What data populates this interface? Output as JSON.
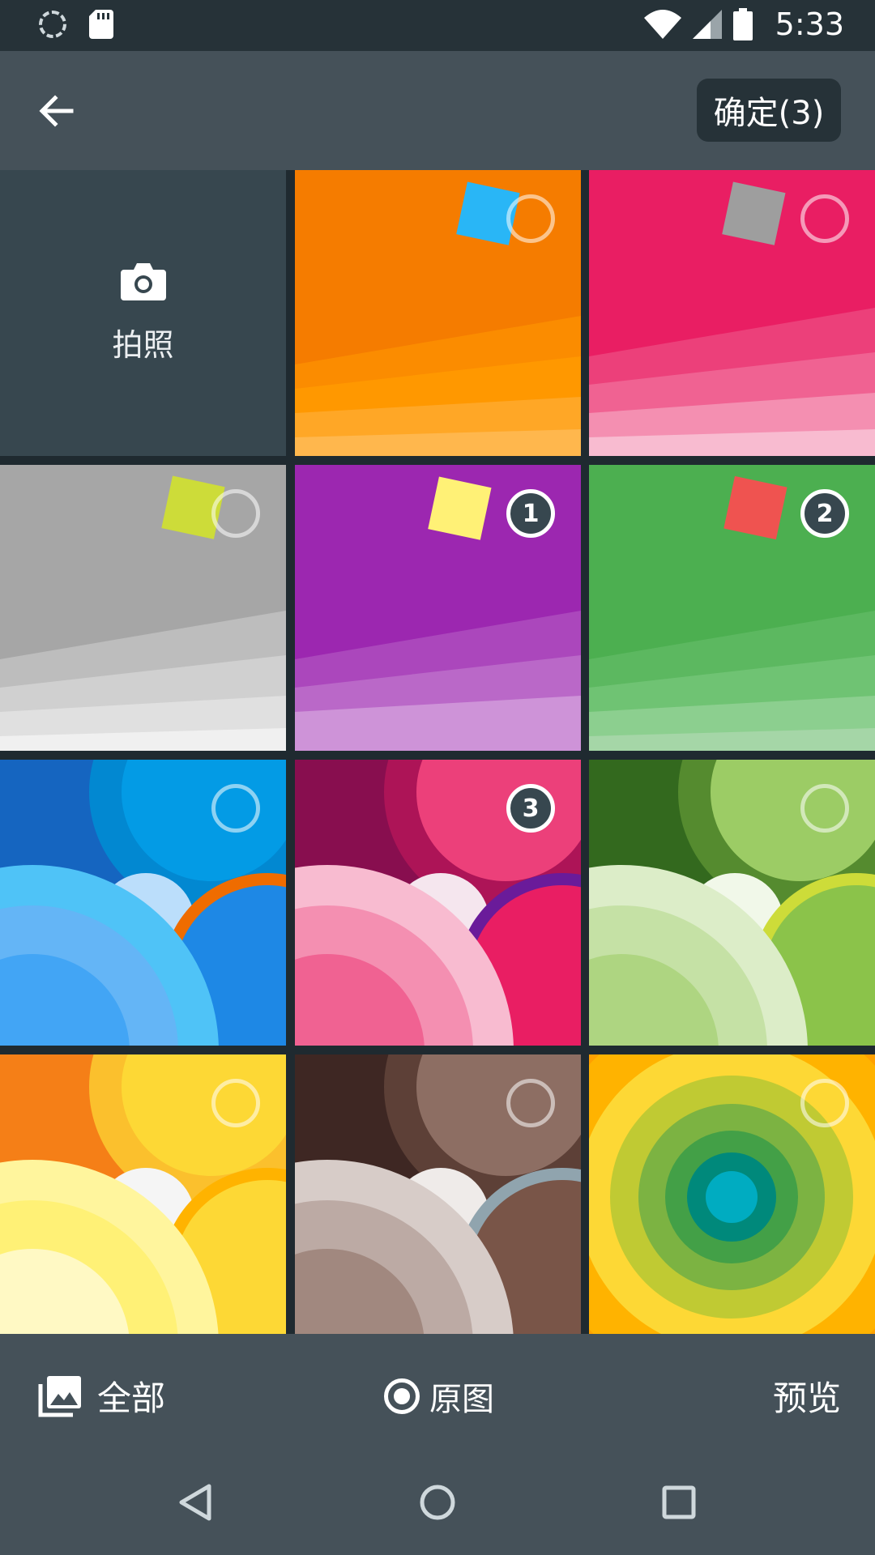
{
  "status_bar": {
    "time": "5:33",
    "icons": [
      "loading-spinner-icon",
      "sd-card-icon",
      "wifi-icon",
      "signal-icon",
      "battery-icon"
    ]
  },
  "toolbar": {
    "back_icon": "arrow-left-icon",
    "confirm_label": "确定(3)"
  },
  "grid": {
    "camera_label": "拍照",
    "camera_icon": "camera-icon",
    "tiles": [
      {
        "style": "orange-beams",
        "selected": false
      },
      {
        "style": "pink-beams",
        "selected": false
      },
      {
        "style": "gray-beams",
        "selected": false
      },
      {
        "style": "purple-beams",
        "selected": true,
        "order": "1"
      },
      {
        "style": "green-beams",
        "selected": true,
        "order": "2"
      },
      {
        "style": "blue-circles",
        "selected": false
      },
      {
        "style": "pink-circles",
        "selected": true,
        "order": "3"
      },
      {
        "style": "green-circles",
        "selected": false
      },
      {
        "style": "yellow-circles",
        "selected": false
      },
      {
        "style": "brown-circles",
        "selected": false
      },
      {
        "style": "concentric-rings",
        "selected": false
      }
    ]
  },
  "bottom_bar": {
    "all_label": "全部",
    "original_label": "原图",
    "preview_label": "预览"
  },
  "nav_bar": {
    "icons": [
      "back-triangle-icon",
      "home-circle-icon",
      "recents-square-icon"
    ]
  },
  "colors": {
    "toolbar": "#455159",
    "status_bar": "#263238",
    "camera_tile": "#37474f",
    "selected_badge": "#37474f"
  }
}
